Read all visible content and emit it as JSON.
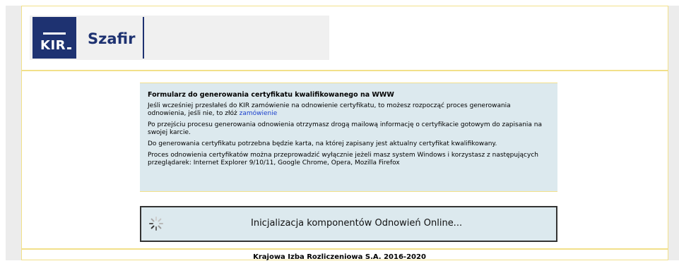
{
  "header": {
    "logo_kir": "KIR",
    "logo_szafir": "Szafir"
  },
  "form": {
    "title": "Formularz do generowania certyfikatu kwalifikowanego na WWW",
    "p1_text": "Jeśli wcześniej przesłałeś do KIR zamówienie na odnowienie certyfikatu, to możesz rozpocząć proces generowania odnowienia, jeśli nie, to złóż ",
    "p1_link": "zamówienie",
    "p2": "Po przejściu procesu generowania odnowienia otrzymasz drogą mailową informację o certyfikacie gotowym do zapisania na swojej karcie.",
    "p3": "Do generowania certyfikatu potrzebna będzie karta, na której zapisany jest aktualny certyfikat kwalifikowany.",
    "p4": "Proces odnowienia certyfikatów można przeprowadzić wyłącznie jeżeli masz system Windows i korzystasz z następujących przeglądarek: Internet Explorer 9/10/11, Google Chrome, Opera, Mozilla Firefox"
  },
  "status": {
    "message": "Inicjalizacja komponentów Odnowień Online...",
    "icon": "loading-spinner-icon"
  },
  "footer": {
    "text": "Krajowa Izba Rozliczeniowa S.A. 2016-2020"
  },
  "colors": {
    "brand": "#1e3271",
    "panel_bg": "#dce9ee",
    "frame_border": "#f2e08a",
    "link": "#1a3fcc"
  }
}
